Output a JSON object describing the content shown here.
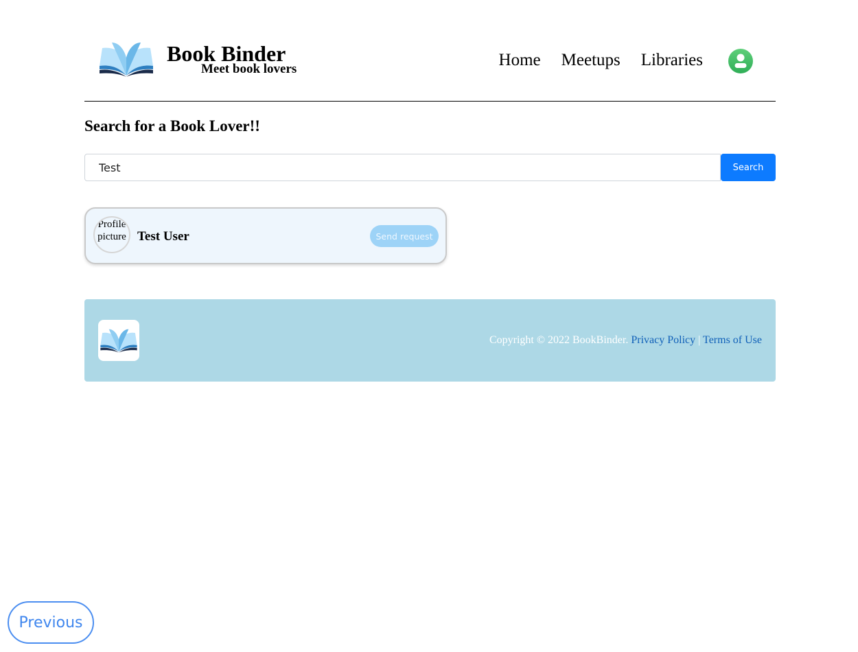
{
  "header": {
    "brand_title": "Book Binder",
    "brand_tagline": "Meet book lovers",
    "nav": [
      {
        "label": "Home"
      },
      {
        "label": "Meetups"
      },
      {
        "label": "Libraries"
      }
    ],
    "avatar_icon": "user-circle-icon"
  },
  "main": {
    "heading": "Search for a Book Lover!!",
    "search": {
      "value": "Test",
      "button_label": "Search"
    },
    "results": [
      {
        "profile_picture_alt": "Profile picture",
        "name": "Test User",
        "action_label": "Send request"
      }
    ]
  },
  "footer": {
    "copyright": "Copyright © 2022 BookBinder.",
    "privacy_label": "Privacy Policy",
    "separator": "|",
    "terms_label": "Terms of Use"
  },
  "pagination": {
    "previous_label": "Previous"
  },
  "colors": {
    "primary": "#0d7bff",
    "footer_bg": "#add8e6",
    "card_bg": "#eef6fd",
    "send_request_bg": "#9dd3f7",
    "avatar": "#2fae57",
    "link": "#0f5fb8"
  }
}
